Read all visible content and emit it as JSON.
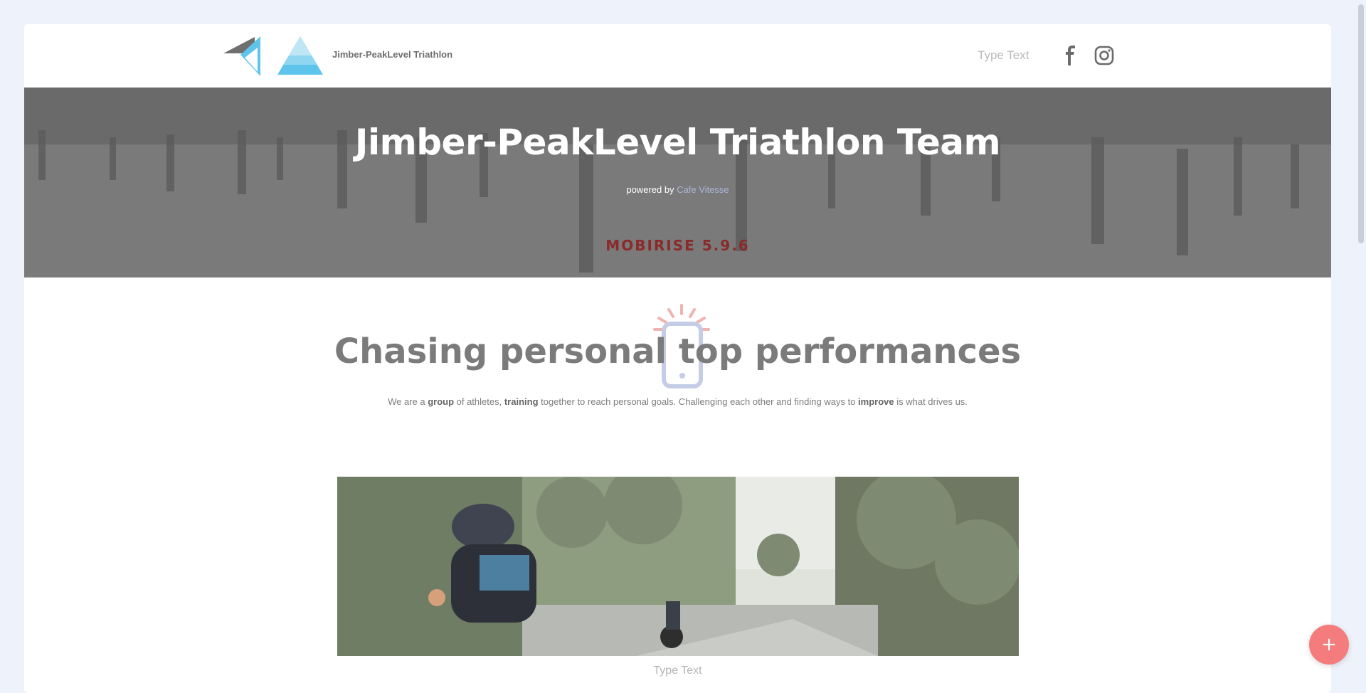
{
  "header": {
    "brand": "Jimber-PeakLevel Triathlon",
    "nav_link": "Type Text",
    "icons": [
      "facebook-icon",
      "instagram-icon"
    ]
  },
  "hero": {
    "title": "Jimber-PeakLevel Triathlon Team",
    "powered_prefix": "powered by",
    "powered_link": "Cafe Vitesse",
    "badge": "MOBIRISE  5.9.6"
  },
  "section": {
    "title": "Chasing personal top performances",
    "text_parts": [
      "We are a ",
      "group",
      " of athletes, ",
      "training",
      " together to reach personal goals. Challenging each other and finding ways to ",
      "improve",
      " is what drives us."
    ]
  },
  "photo": {
    "caption": "Type Text"
  },
  "fab": {
    "label": "+"
  },
  "colors": {
    "accent": "#f47c7c",
    "badge": "#8b2a2a",
    "link": "#aab7d6",
    "logo_blue": "#5ec4ec"
  }
}
